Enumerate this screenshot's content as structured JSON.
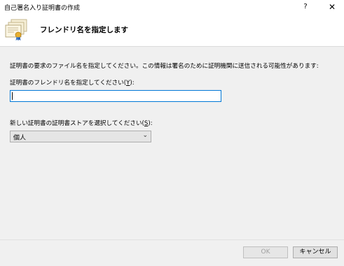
{
  "window": {
    "title": "自己署名入り証明書の作成",
    "help_glyph": "?",
    "close_glyph": "✕"
  },
  "header": {
    "title": "フレンドリ名を指定します",
    "icon": "certificate-icon"
  },
  "main": {
    "description": "証明書の要求のファイル名を指定してください。この情報は署名のために証明機関に送信される可能性があります:",
    "friendly_name_label_prefix": "証明書のフレンドリ名を指定してください(",
    "friendly_name_label_key": "Y",
    "friendly_name_label_suffix": "):",
    "friendly_name_value": "",
    "store_label_prefix": "新しい証明書の証明書ストアを選択してください(",
    "store_label_key": "S",
    "store_label_suffix": "):",
    "store_selected": "個人"
  },
  "buttons": {
    "ok": "OK",
    "cancel": "キャンセル"
  },
  "colors": {
    "focus_border": "#0078d7",
    "background": "#f0f0f0"
  }
}
